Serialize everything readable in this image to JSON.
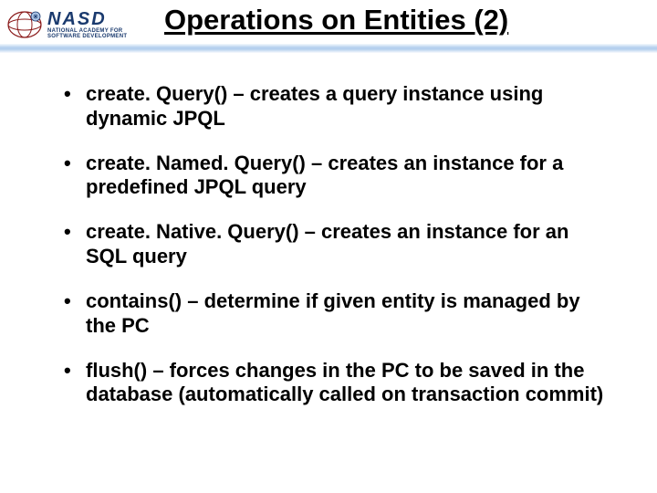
{
  "header": {
    "logo_main": "NASD",
    "logo_sub1": "NATIONAL ACADEMY FOR",
    "logo_sub2": "SOFTWARE DEVELOPMENT",
    "title": "Operations on Entities (2)"
  },
  "bullets": [
    {
      "fn": "create. Query()",
      "desc": " – creates a query instance using dynamic JPQL"
    },
    {
      "fn": "create. Named. Query()",
      "desc": " – creates an instance for a predefined JPQL query"
    },
    {
      "fn": "create. Native. Query()",
      "desc": " – creates an instance for an SQL query"
    },
    {
      "fn": "contains()",
      "desc": " – determine if given entity is managed by the PC"
    },
    {
      "fn": "flush()",
      "desc": " – forces changes in the PC to be saved in the database (automatically called on transaction commit)"
    }
  ]
}
